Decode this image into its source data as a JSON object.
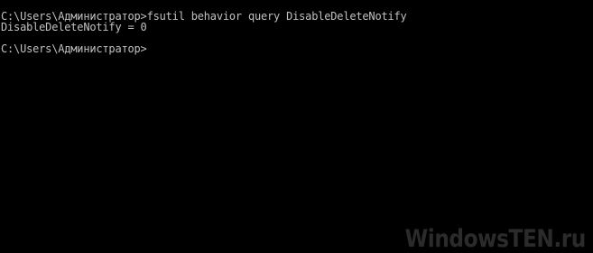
{
  "console": {
    "lines": [
      "C:\\Users\\Администратор>fsutil behavior query DisableDeleteNotify",
      "DisableDeleteNotify = 0",
      "C:\\Users\\Администратор>"
    ],
    "text_color": "#c0c0c0",
    "background_color": "#000000"
  },
  "watermark": {
    "text": "WindowsTEN.ru"
  }
}
